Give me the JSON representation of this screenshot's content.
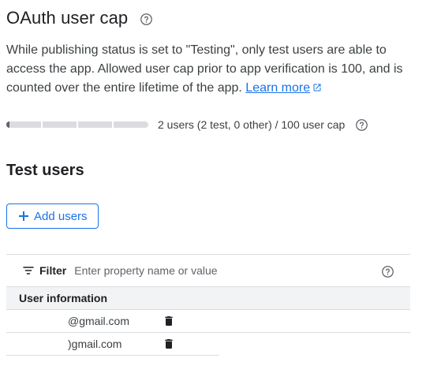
{
  "oauth_cap": {
    "title": "OAuth user cap",
    "description": "While publishing status is set to \"Testing\", only test users are able to access the app. Allowed user cap prior to app verification is 100, and is counted over the entire lifetime of the app. ",
    "learn_more_label": "Learn more",
    "progress_fraction": 0.02,
    "cap_text": "2 users (2 test, 0 other) / 100 user cap"
  },
  "test_users": {
    "title": "Test users",
    "add_button_label": "Add users",
    "filter": {
      "label": "Filter",
      "placeholder": "Enter property name or value"
    },
    "column_header": "User information",
    "rows": [
      {
        "email": "@gmail.com"
      },
      {
        "email": ")gmail.com"
      }
    ]
  },
  "icons": {
    "help": "help-circle-icon",
    "external_link": "open-in-new-icon",
    "add": "plus-icon",
    "filter": "filter-list-icon",
    "delete": "trash-icon"
  },
  "colors": {
    "accent": "#1a73e8",
    "text_primary": "#202124",
    "text_secondary": "#3c4043",
    "icon": "#5f6368",
    "divider": "#dadce0",
    "header_bg": "#f1f3f4"
  }
}
